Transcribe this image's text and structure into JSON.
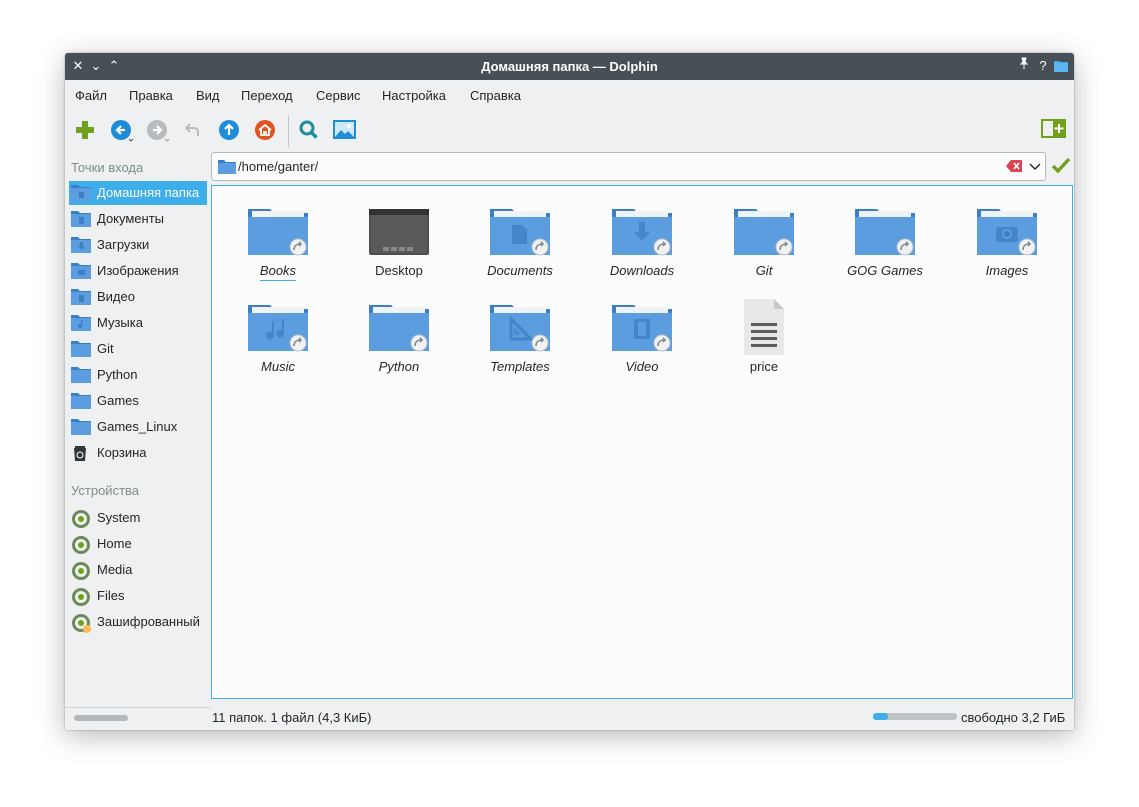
{
  "window": {
    "title": "Домашняя папка — Dolphin"
  },
  "titlebar_buttons": {
    "close": "✕",
    "minimize": "⌄",
    "maximize": "⌃",
    "pin": "📌",
    "help": "?"
  },
  "menu": [
    "Файл",
    "Правка",
    "Вид",
    "Переход",
    "Сервис",
    "Настройка",
    "Справка"
  ],
  "toolbar": {
    "icons": [
      "new-folder-icon",
      "back-icon",
      "forward-icon",
      "undo-icon",
      "up-icon",
      "home-icon",
      "search-icon",
      "preview-icon",
      "split-view-icon"
    ]
  },
  "location": {
    "path": "/home/ganter/"
  },
  "sidebar": {
    "places_header": "Точки входа",
    "places": [
      {
        "label": "Домашняя папка",
        "icon": "home-folder-icon",
        "active": true
      },
      {
        "label": "Документы",
        "icon": "documents-folder-icon"
      },
      {
        "label": "Загрузки",
        "icon": "downloads-folder-icon"
      },
      {
        "label": "Изображения",
        "icon": "pictures-folder-icon"
      },
      {
        "label": "Видео",
        "icon": "videos-folder-icon"
      },
      {
        "label": "Музыка",
        "icon": "music-folder-icon"
      },
      {
        "label": "Git",
        "icon": "folder-icon"
      },
      {
        "label": "Python",
        "icon": "folder-icon"
      },
      {
        "label": "Games",
        "icon": "folder-icon"
      },
      {
        "label": "Games_Linux",
        "icon": "folder-icon"
      },
      {
        "label": "Корзина",
        "icon": "trash-icon"
      }
    ],
    "devices_header": "Устройства",
    "devices": [
      {
        "label": "System",
        "icon": "drive-icon"
      },
      {
        "label": "Home",
        "icon": "drive-icon"
      },
      {
        "label": "Media",
        "icon": "drive-icon"
      },
      {
        "label": "Files",
        "icon": "drive-icon"
      },
      {
        "label": "Зашифрованный",
        "icon": "encrypted-drive-icon"
      }
    ]
  },
  "files": [
    {
      "name": "Books",
      "type": "folder-link",
      "emblem": "none"
    },
    {
      "name": "Desktop",
      "type": "desktop",
      "emblem": "none"
    },
    {
      "name": "Documents",
      "type": "folder-link",
      "emblem": "document"
    },
    {
      "name": "Downloads",
      "type": "folder-link",
      "emblem": "download"
    },
    {
      "name": "Git",
      "type": "folder-link",
      "emblem": "none"
    },
    {
      "name": "GOG Games",
      "type": "folder-link",
      "emblem": "none"
    },
    {
      "name": "Images",
      "type": "folder-link",
      "emblem": "camera"
    },
    {
      "name": "Music",
      "type": "folder-link",
      "emblem": "music"
    },
    {
      "name": "Python",
      "type": "folder-link",
      "emblem": "none"
    },
    {
      "name": "Templates",
      "type": "folder-link",
      "emblem": "template"
    },
    {
      "name": "Video",
      "type": "folder-link",
      "emblem": "video"
    },
    {
      "name": "price",
      "type": "text-file",
      "emblem": "none"
    }
  ],
  "status": {
    "summary": "11 папок. 1 файл (4,3 КиБ)",
    "free_space": "свободно 3,2 ГиБ",
    "used_fraction": 0.18
  },
  "colors": {
    "accent": "#3daee9",
    "titlebar": "#475057",
    "folder": "#5c9de0"
  }
}
